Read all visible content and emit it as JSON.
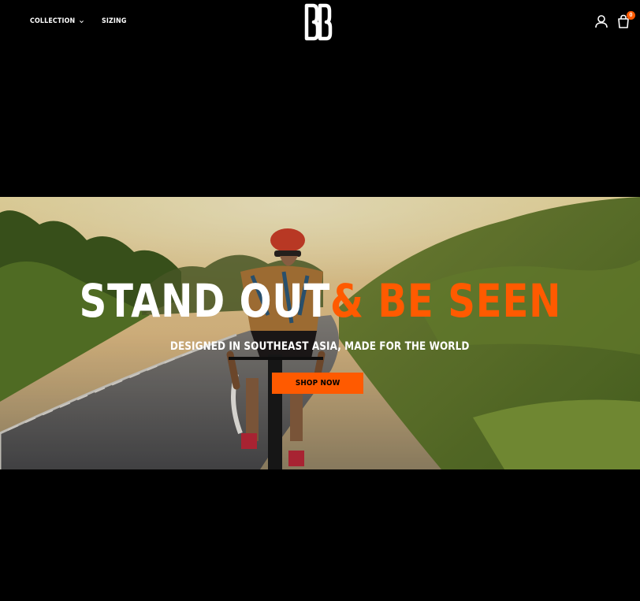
{
  "header": {
    "nav": [
      {
        "label": "COLLECTION",
        "has_dropdown": true
      },
      {
        "label": "SIZING",
        "has_dropdown": false
      }
    ],
    "logo_icon": "bb-logo-icon",
    "account_icon": "user-icon",
    "cart_icon": "shopping-bag-icon",
    "cart_count": "0"
  },
  "hero": {
    "title_white": "STAND OUT ",
    "title_orange": "& BE SEEN",
    "subtitle": "DESIGNED IN SOUTHEAST ASIA, MADE FOR THE WORLD",
    "cta_label": "SHOP NOW"
  },
  "colors": {
    "background": "#000000",
    "accent": "#ff5a00",
    "text": "#ffffff"
  }
}
